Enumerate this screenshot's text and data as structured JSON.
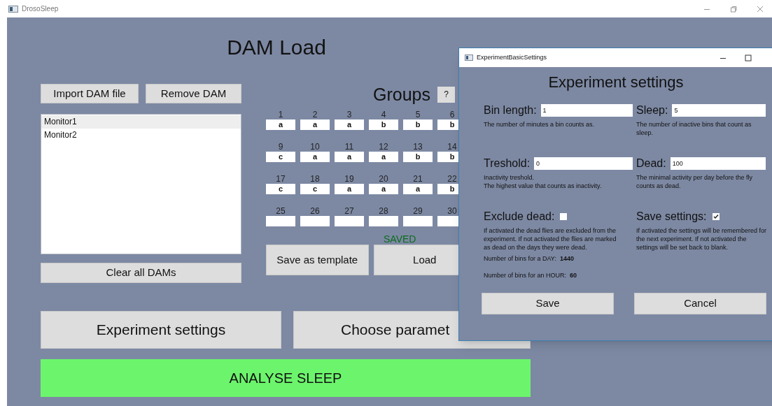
{
  "window": {
    "title": "DrosoSleep"
  },
  "main": {
    "title": "DAM Load",
    "import_button": "Import DAM file",
    "remove_button": "Remove DAM",
    "dam_list": [
      {
        "label": "Monitor1",
        "selected": true
      },
      {
        "label": "Monitor2",
        "selected": false
      }
    ],
    "clear_button": "Clear all DAMs"
  },
  "groups": {
    "title": "Groups",
    "help_button": "?",
    "cells": [
      {
        "number": "1",
        "value": "a"
      },
      {
        "number": "2",
        "value": "a"
      },
      {
        "number": "3",
        "value": "a"
      },
      {
        "number": "4",
        "value": "b"
      },
      {
        "number": "5",
        "value": "b"
      },
      {
        "number": "6",
        "value": "b"
      },
      {
        "number": "9",
        "value": "c"
      },
      {
        "number": "10",
        "value": "a"
      },
      {
        "number": "11",
        "value": "a"
      },
      {
        "number": "12",
        "value": "a"
      },
      {
        "number": "13",
        "value": "b"
      },
      {
        "number": "14",
        "value": "b"
      },
      {
        "number": "17",
        "value": "c"
      },
      {
        "number": "18",
        "value": "c"
      },
      {
        "number": "19",
        "value": "a"
      },
      {
        "number": "20",
        "value": "a"
      },
      {
        "number": "21",
        "value": "a"
      },
      {
        "number": "22",
        "value": "b"
      },
      {
        "number": "25"
      },
      {
        "number": "26"
      },
      {
        "number": "27"
      },
      {
        "number": "28"
      },
      {
        "number": "29"
      },
      {
        "number": "30"
      }
    ],
    "status": "SAVED",
    "save_template_button": "Save as template",
    "load_button": "Load"
  },
  "experiment_settings_button": "Experiment settings",
  "choose_parameters_button": "Choose paramet",
  "analyse_button": "ANALYSE SLEEP",
  "dialog": {
    "title": "ExperimentBasicSettings",
    "heading": "Experiment settings",
    "fields": [
      {
        "label": "Bin length:",
        "value": "1",
        "description": "The number of minutes a bin counts as."
      },
      {
        "label": "Sleep:",
        "value": "5",
        "description": "The number of inactive bins that count as sleep."
      },
      {
        "label": "Treshold:",
        "value": "0",
        "description": "Inactivity treshold.\nThe highest value that counts as inactivity."
      },
      {
        "label": "Dead:",
        "value": "100",
        "description": "The minimal activity per day before the fly counts as dead."
      }
    ],
    "checkboxes": [
      {
        "label": "Exclude dead:",
        "checked": false,
        "description": "If activated the dead flies are excluded from the experiment. If not activated the flies are marked as dead on the days they were dead."
      },
      {
        "label": "Save settings:",
        "checked": true,
        "description": "If activated the settings will be remembered for the next experiment. If not activated the settings will be set back to blank."
      }
    ],
    "info": [
      {
        "label": "Number of bins for a DAY:",
        "value": "1440"
      },
      {
        "label": "Number of bins for an HOUR:",
        "value": "60"
      }
    ],
    "save_button": "Save",
    "cancel_button": "Cancel"
  }
}
